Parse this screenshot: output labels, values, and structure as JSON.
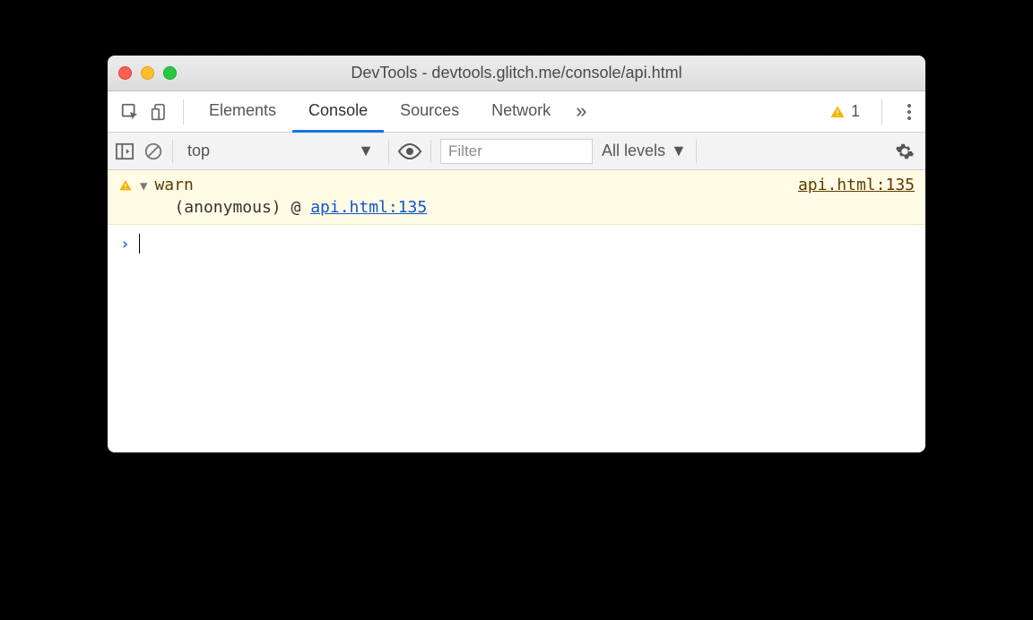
{
  "window": {
    "title": "DevTools - devtools.glitch.me/console/api.html"
  },
  "tabs": {
    "items": [
      "Elements",
      "Console",
      "Sources",
      "Network"
    ],
    "active_index": 1,
    "overflow_glyph": "»",
    "warning_count": "1"
  },
  "toolbar": {
    "context": "top",
    "filter_placeholder": "Filter",
    "levels_label": "All levels"
  },
  "console": {
    "entries": [
      {
        "level": "warn",
        "message": "warn",
        "source_link": "api.html:135",
        "stack": {
          "frame": "(anonymous)",
          "at": "@",
          "link": "api.html:135"
        }
      }
    ],
    "prompt_glyph": "›"
  }
}
